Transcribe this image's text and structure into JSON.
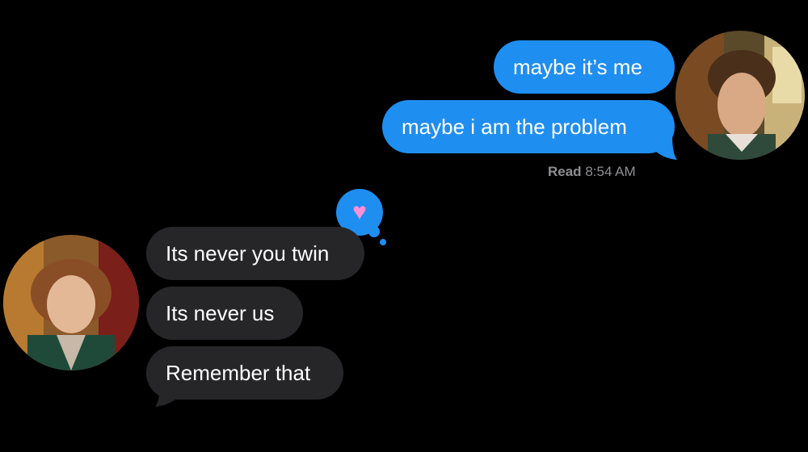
{
  "conversation": {
    "sent_messages": [
      {
        "text": "maybe it’s me"
      },
      {
        "text": "maybe i am the problem"
      }
    ],
    "read_receipt": {
      "status": "Read",
      "time": "8:54 AM"
    },
    "received_messages": [
      {
        "text": "Its never you twin"
      },
      {
        "text": "Its never us"
      },
      {
        "text": "Remember that"
      }
    ],
    "tapback": {
      "icon": "heart-icon",
      "color": "#ff8fd6"
    }
  },
  "colors": {
    "sent_bubble": "#1f8ef1",
    "received_bubble": "#262628",
    "background": "#000000",
    "receipt_text": "#8e8e93"
  }
}
